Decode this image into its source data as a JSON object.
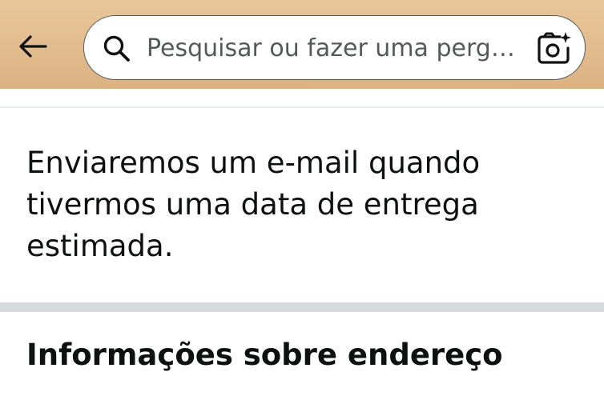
{
  "header": {
    "back_icon": "arrow-left-icon",
    "search": {
      "placeholder": "Pesquisar ou fazer uma perg…",
      "value": "",
      "search_icon": "search-icon",
      "camera_icon": "camera-lens-icon"
    },
    "colors": {
      "background": "#dcb283",
      "search_border": "#5a5a5a"
    }
  },
  "main": {
    "message": "Enviaremos um e-mail quando tivermos uma data de entrega estimada.",
    "section_title": "Informações sobre endereço"
  }
}
